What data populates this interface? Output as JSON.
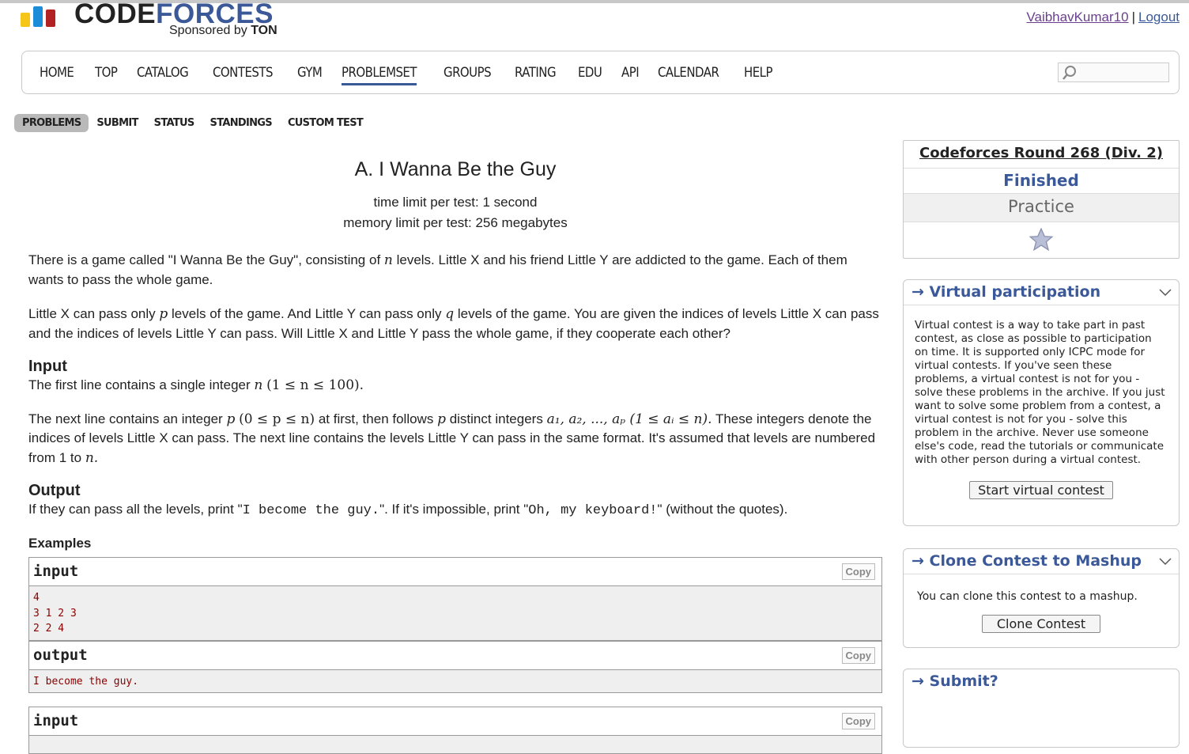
{
  "header": {
    "logo_text_a": "CODE",
    "logo_text_b": "FORCES",
    "sponsored_prefix": "Sponsored by",
    "sponsor": "TON",
    "username": "VaibhavKumar10",
    "separator": "|",
    "logout": "Logout"
  },
  "colors": {
    "logo_bar_yellow": "#f5c518",
    "logo_bar_blue": "#1a8cd8",
    "logo_bar_red": "#b22222",
    "brand_blue": "#3b5998"
  },
  "main_menu": {
    "items": [
      "HOME",
      "TOP",
      "CATALOG",
      "CONTESTS",
      "GYM",
      "PROBLEMSET",
      "GROUPS",
      "RATING",
      "EDU",
      "API",
      "CALENDAR",
      "HELP"
    ],
    "active": "PROBLEMSET",
    "search_placeholder": ""
  },
  "sub_menu": {
    "items": [
      "PROBLEMS",
      "SUBMIT",
      "STATUS",
      "STANDINGS",
      "CUSTOM TEST"
    ],
    "active": "PROBLEMS"
  },
  "problem": {
    "title": "A. I Wanna Be the Guy",
    "time_limit": "time limit per test: 1 second",
    "memory_limit": "memory limit per test: 256 megabytes",
    "legend_1_a": "There is a game called \"I Wanna Be the Guy\", consisting of",
    "legend_1_var": "n",
    "legend_1_b": "levels. Little X and his friend Little Y are addicted to the game. Each of them wants to pass the whole game.",
    "legend_2_a": "Little X can pass only",
    "legend_2_p": "p",
    "legend_2_b": "levels of the game. And Little Y can pass only",
    "legend_2_q": "q",
    "legend_2_c": "levels of the game. You are given the indices of levels Little X can pass and the indices of levels Little Y can pass. Will Little X and Little Y pass the whole game, if they cooperate each other?",
    "input_title": "Input",
    "input_1_a": "The first line contains a single integer",
    "input_1_n": "n",
    "input_1_math": "(1 ≤ n ≤ 100).",
    "input_2_a": "The next line contains an integer",
    "input_2_p": "p",
    "input_2_math1": "(0 ≤ p ≤ n)",
    "input_2_b": "at first, then follows",
    "input_2_p2": "p",
    "input_2_c": "distinct integers",
    "input_2_math2": "a₁, a₂, ..., aₚ (1 ≤ aᵢ ≤ n).",
    "input_2_d": "These integers denote the indices of levels Little X can pass. The next line contains the levels Little Y can pass in the same format. It's assumed that levels are numbered from 1 to",
    "input_2_n": "n.",
    "output_title": "Output",
    "output_a": "If they can pass all the levels, print \"",
    "output_mono1": "I become the guy.",
    "output_b": "\". If it's impossible, print \"",
    "output_mono2": "Oh, my keyboard!",
    "output_c": "\" (without the quotes).",
    "examples_title": "Examples"
  },
  "examples": {
    "input_label": "input",
    "output_label": "output",
    "copy_label": "Copy",
    "example1_input": "4\n3 1 2 3\n2 2 4",
    "example1_output": "I become the guy."
  },
  "sidebar": {
    "contest_name": "Codeforces Round 268 (Div. 2)",
    "status": "Finished",
    "mode": "Practice",
    "virtual_title": "→ Virtual participation",
    "virtual_text": "Virtual contest is a way to take part in past contest, as close as possible to participation on time. It is supported only ICPC mode for virtual contests. If you've seen these problems, a virtual contest is not for you - solve these problems in the archive. If you just want to solve some problem from a contest, a virtual contest is not for you - solve this problem in the archive. Never use someone else's code, read the tutorials or communicate with other person during a virtual contest.",
    "virtual_button": "Start virtual contest",
    "clone_title": "→ Clone Contest to Mashup",
    "clone_text": "You can clone this contest to a mashup.",
    "clone_button": "Clone Contest",
    "submit_title": "→ Submit?"
  }
}
